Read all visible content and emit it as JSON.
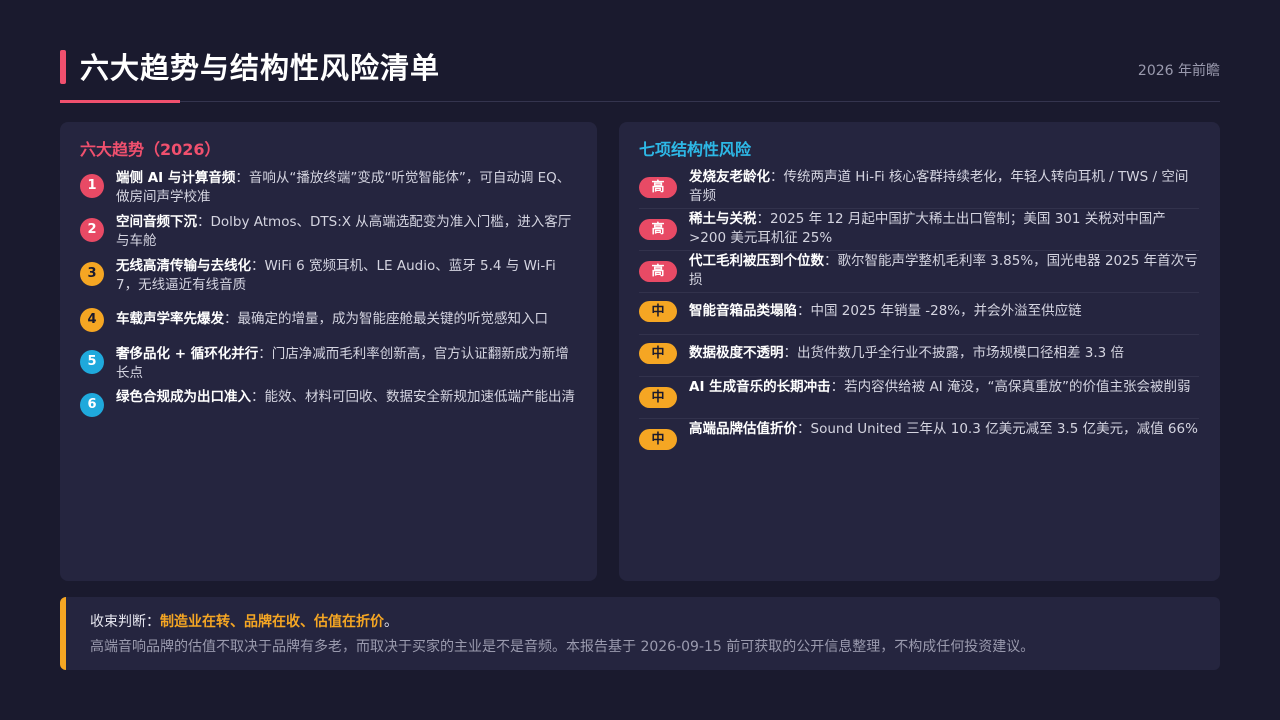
{
  "header": {
    "title": "六大趋势与结构性风险清单",
    "subtitle": "2026 年前瞻"
  },
  "trends": {
    "heading": "六大趋势（2026）",
    "items": [
      {
        "num": "1",
        "title": "端侧 AI 与计算音频",
        "desc": "：音响从“播放终端”变成“听觉智能体”，可自动调 EQ、做房间声学校准"
      },
      {
        "num": "2",
        "title": "空间音频下沉",
        "desc": "：Dolby Atmos、DTS:X 从高端选配变为准入门槛，进入客厅与车舱"
      },
      {
        "num": "3",
        "title": "无线高清传输与去线化",
        "desc": "：WiFi 6 宽频耳机、LE Audio、蓝牙 5.4 与 Wi-Fi 7，无线逼近有线音质"
      },
      {
        "num": "4",
        "title": "车载声学率先爆发",
        "desc": "：最确定的增量，成为智能座舱最关键的听觉感知入口"
      },
      {
        "num": "5",
        "title": "奢侈品化 + 循环化并行",
        "desc": "：门店净减而毛利率创新高，官方认证翻新成为新增长点"
      },
      {
        "num": "6",
        "title": "绿色合规成为出口准入",
        "desc": "：能效、材料可回收、数据安全新规加速低端产能出清"
      }
    ]
  },
  "risks": {
    "heading": "七项结构性风险",
    "items": [
      {
        "level": "高",
        "title": "发烧友老龄化",
        "desc": "：传统两声道 Hi-Fi 核心客群持续老化，年轻人转向耳机 / TWS / 空间音频"
      },
      {
        "level": "高",
        "title": "稀土与关税",
        "desc": "：2025 年 12 月起中国扩大稀土出口管制；美国 301 关税对中国产 >200 美元耳机征 25%"
      },
      {
        "level": "高",
        "title": "代工毛利被压到个位数",
        "desc": "：歌尔智能声学整机毛利率 3.85%，国光电器 2025 年首次亏损"
      },
      {
        "level": "中",
        "title": "智能音箱品类塌陷",
        "desc": "：中国 2025 年销量 -28%，并会外溢至供应链"
      },
      {
        "level": "中",
        "title": "数据极度不透明",
        "desc": "：出货件数几乎全行业不披露，市场规模口径相差 3.3 倍"
      },
      {
        "level": "中",
        "title": "AI 生成音乐的长期冲击",
        "desc": "：若内容供给被 AI 淹没，“高保真重放”的价值主张会被削弱"
      },
      {
        "level": "中",
        "title": "高端品牌估值折价",
        "desc": "：Sound United 三年从 10.3 亿美元减至 3.5 亿美元，减值 66%"
      }
    ]
  },
  "conclusion": {
    "label": "收束判断：",
    "highlight": "制造业在转、品牌在收、估值在折价",
    "end": "。",
    "note": "高端音响品牌的估值不取决于品牌有多老，而取决于买家的主业是不是音频。本报告基于 2026-09-15 前可获取的公开信息整理，不构成任何投资建议。"
  },
  "colors": {
    "background": "#1a1a2e",
    "card": "#25253f",
    "accent_red": "#f0506e",
    "accent_orange": "#f5a623",
    "accent_blue": "#2db8e6"
  }
}
